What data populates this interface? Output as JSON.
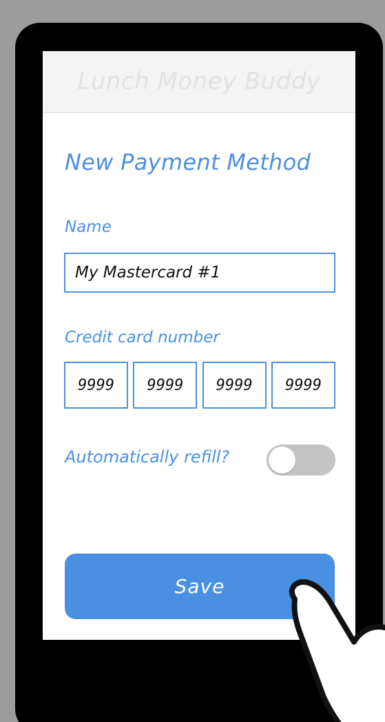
{
  "app": {
    "title": "Lunch Money Buddy"
  },
  "page": {
    "title": "New Payment Method"
  },
  "name_field": {
    "label": "Name",
    "value": "My Mastercard #1"
  },
  "credit_card": {
    "label": "Credit card number",
    "groups": [
      "9999",
      "9999",
      "9999",
      "9999"
    ]
  },
  "refill": {
    "label": "Automatically refill?",
    "enabled": false
  },
  "save": {
    "label": "Save"
  },
  "icons": {
    "pointer": "hand-pointer-icon"
  },
  "colors": {
    "accent": "#4a90e2",
    "toggle_off": "#c4c4c4",
    "frame": "#000000",
    "background": "#9c9c9c"
  }
}
